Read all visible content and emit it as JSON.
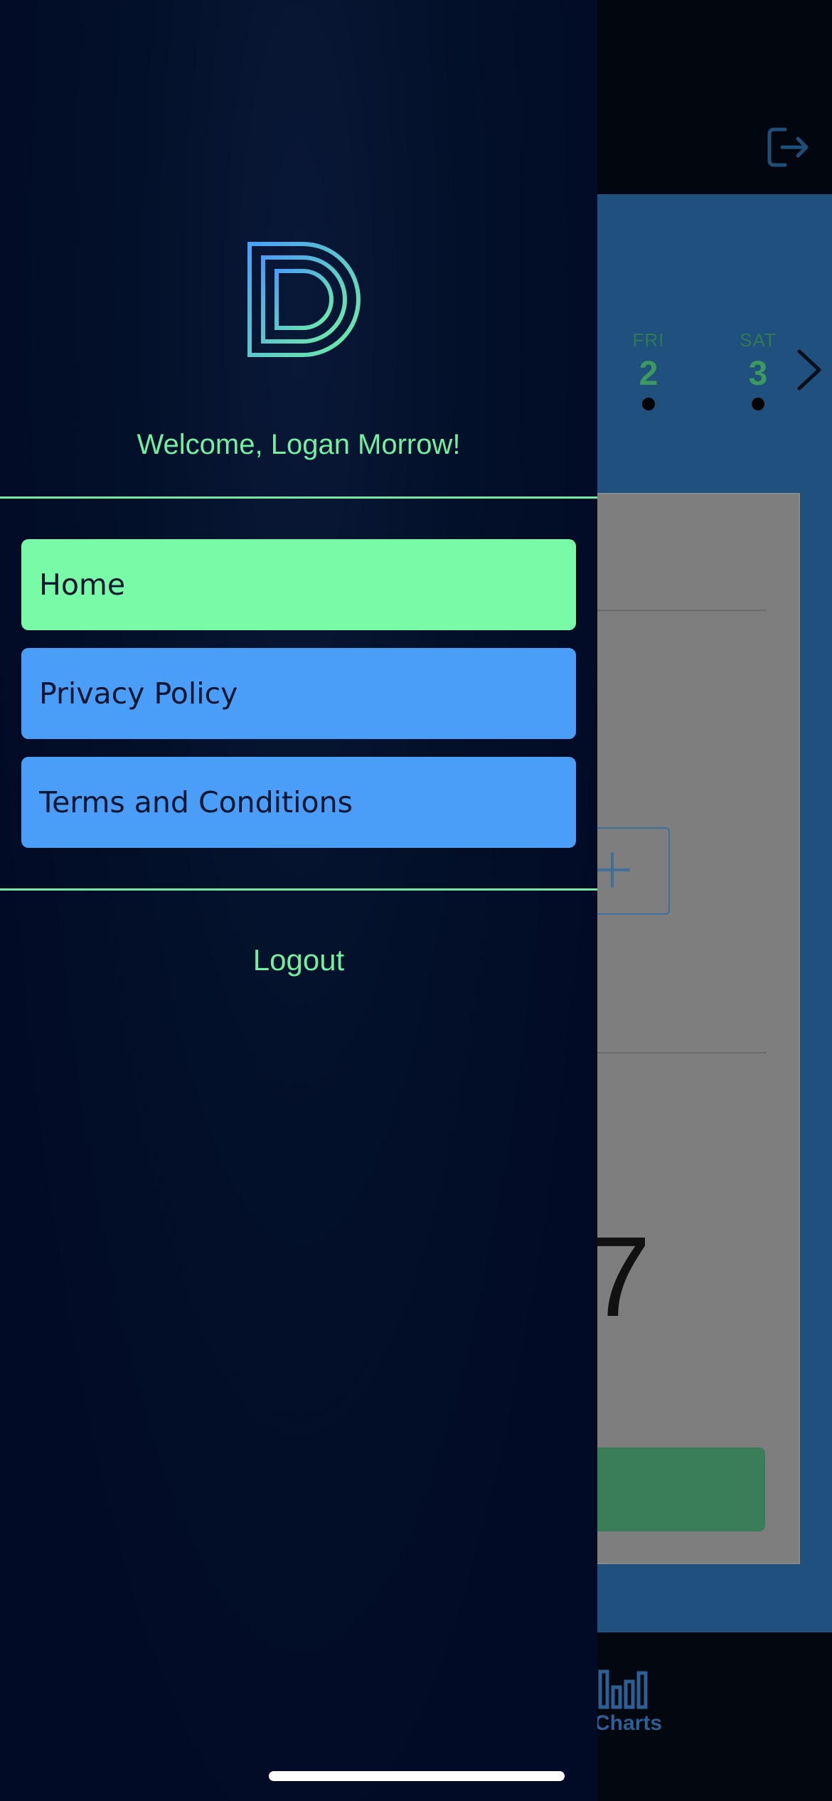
{
  "background": {
    "week_days": [
      {
        "name": "FRI",
        "number": "2"
      },
      {
        "name": "SAT",
        "number": "3"
      }
    ],
    "card_value_fragment": "7",
    "tab_bar": {
      "charts_label": "Charts"
    }
  },
  "drawer": {
    "welcome_text": "Welcome, Logan Morrow!",
    "menu": [
      {
        "label": "Home",
        "active": true
      },
      {
        "label": "Privacy Policy",
        "active": false
      },
      {
        "label": "Terms and Conditions",
        "active": false
      }
    ],
    "logout_label": "Logout"
  },
  "colors": {
    "accent_green": "#78faa6",
    "accent_blue": "#4a9ef7",
    "drawer_bg": "#020b26"
  },
  "icons": [
    "logout-icon",
    "chevron-right-icon",
    "plus-icon",
    "bar-chart-icon",
    "app-logo"
  ]
}
